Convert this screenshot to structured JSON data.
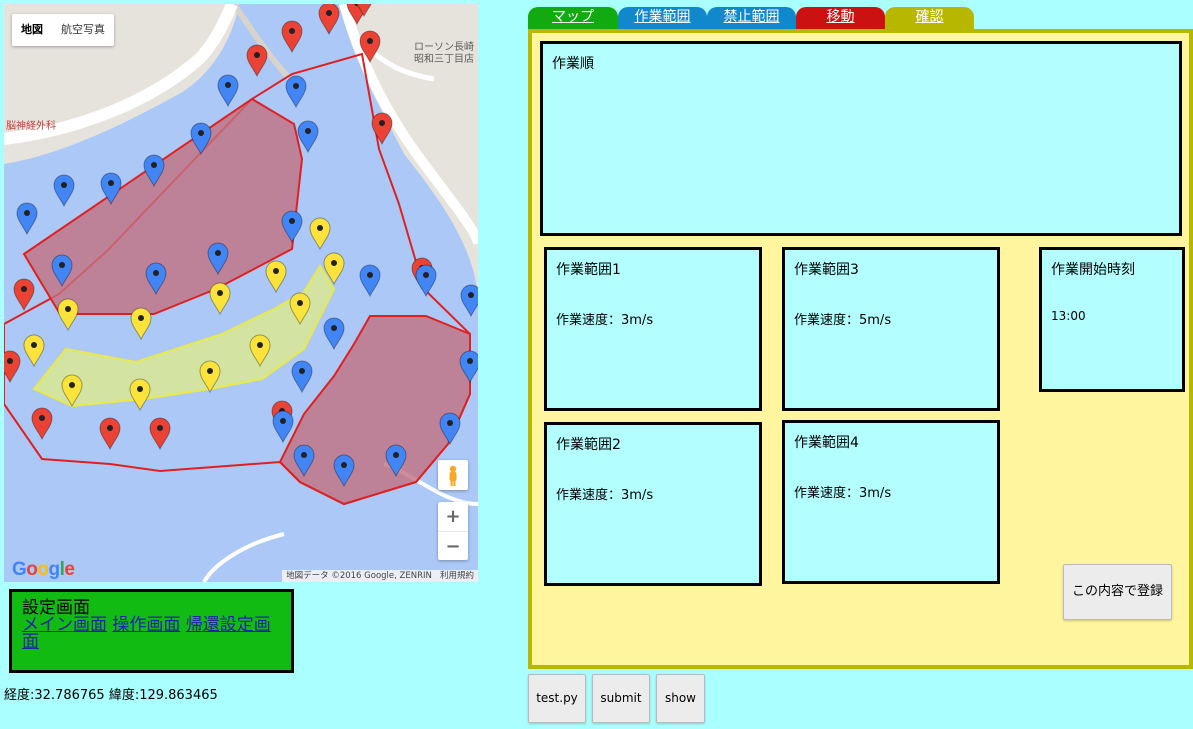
{
  "map": {
    "maptype_buttons": [
      "地図",
      "航空写真"
    ],
    "labels": {
      "store": "ローソン長崎",
      "store2": "昭和三丁目店",
      "hospital": "脳神経外科"
    },
    "logo": "Google",
    "attribution": "地図データ ©2016 Google, ZENRIN",
    "terms": "利用規約",
    "zoom_in": "+",
    "zoom_out": "−"
  },
  "settings": {
    "title": "設定画面",
    "links": [
      "メイン画面",
      "操作画面",
      "帰還設定画面"
    ]
  },
  "coords": "経度:32.786765 緯度:129.863465",
  "tabs": [
    {
      "label": "マップ",
      "color": "#11aa11"
    },
    {
      "label": "作業範囲",
      "color": "#1188cc"
    },
    {
      "label": "禁止範囲",
      "color": "#1188cc"
    },
    {
      "label": "移動",
      "color": "#cc1111"
    },
    {
      "label": "確認",
      "color": "#b7b700"
    }
  ],
  "panel": {
    "order_title": "作業順",
    "areas": [
      {
        "title": "作業範囲1",
        "speed": "作業速度：3m/s"
      },
      {
        "title": "作業範囲3",
        "speed": "作業速度：5m/s"
      },
      {
        "title": "作業範囲2",
        "speed": "作業速度：3m/s"
      },
      {
        "title": "作業範囲4",
        "speed": "作業速度：3m/s"
      }
    ],
    "start": {
      "title": "作業開始時刻",
      "value": "13:00"
    },
    "register_button": "この内容で登録"
  },
  "bottom_buttons": [
    "test.py",
    "submit",
    "show"
  ],
  "colors": {
    "background": "#aaffff",
    "panel": "#fff59e",
    "panel_border": "#b7b700",
    "box": "#b3ffff",
    "settings_box": "#11bb11"
  }
}
